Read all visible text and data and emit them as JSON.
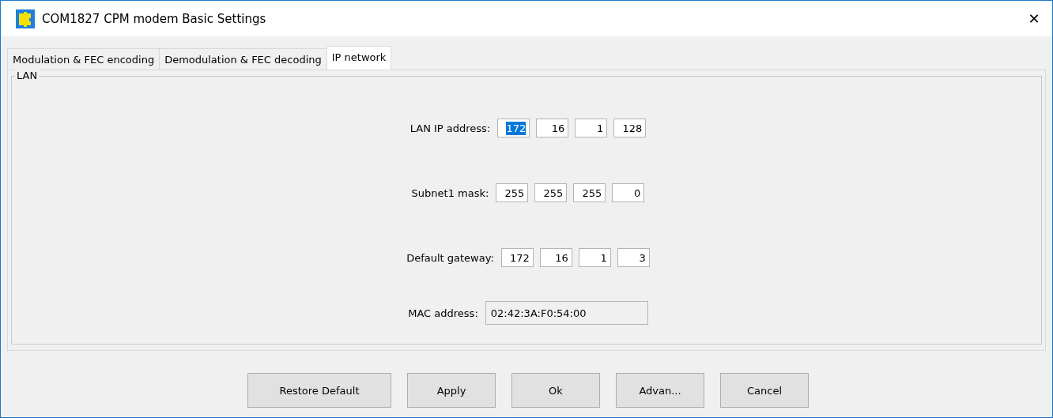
{
  "window": {
    "title": "COM1827 CPM modem Basic Settings",
    "close": "✕"
  },
  "tabs": [
    {
      "label": "Modulation & FEC encoding",
      "selected": false
    },
    {
      "label": "Demodulation & FEC decoding",
      "selected": false
    },
    {
      "label": "IP network",
      "selected": true
    }
  ],
  "group": {
    "title": "LAN",
    "rows": [
      {
        "kind": "ip",
        "label": "LAN IP address:",
        "octets": [
          {
            "value": "172",
            "selected": true
          },
          {
            "value": "16",
            "selected": false
          },
          {
            "value": "1",
            "selected": false
          },
          {
            "value": "128",
            "selected": false
          }
        ]
      },
      {
        "kind": "ip",
        "label": "Subnet1 mask:",
        "octets": [
          {
            "value": "255",
            "selected": false
          },
          {
            "value": "255",
            "selected": false
          },
          {
            "value": "255",
            "selected": false
          },
          {
            "value": "0",
            "selected": false
          }
        ]
      },
      {
        "kind": "ip",
        "label": "Default gateway:",
        "octets": [
          {
            "value": "172",
            "selected": false
          },
          {
            "value": "16",
            "selected": false
          },
          {
            "value": "1",
            "selected": false
          },
          {
            "value": "3",
            "selected": false
          }
        ]
      },
      {
        "kind": "text",
        "label": "MAC address:",
        "value": "02:42:3A:F0:54:00",
        "disabled": true
      }
    ]
  },
  "buttons": [
    "Restore Default",
    "Apply",
    "Ok",
    "Advan...",
    "Cancel"
  ]
}
